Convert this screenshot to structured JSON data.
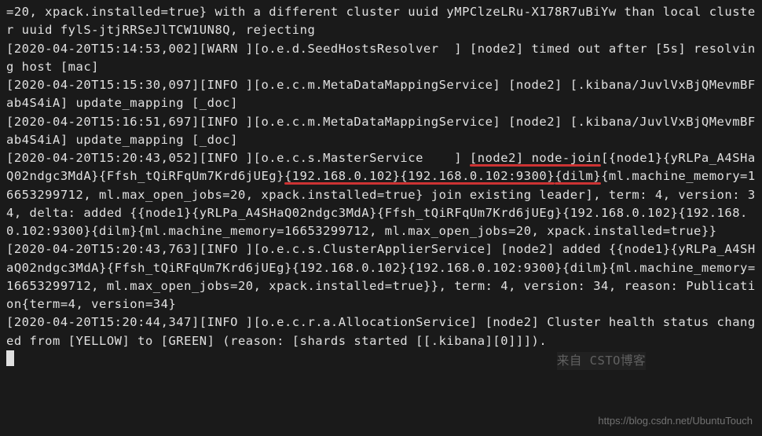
{
  "log": {
    "line1": "=20, xpack.installed=true} with a different cluster uuid yMPClzeLRu-X178R7uBiYw than local cluster uuid fylS-jtjRRSeJlTCW1UN8Q, rejecting",
    "line2": "[2020-04-20T15:14:53,002][WARN ][o.e.d.SeedHostsResolver  ] [node2] timed out after [5s] resolving host [mac]",
    "line3": "[2020-04-20T15:15:30,097][INFO ][o.e.c.m.MetaDataMappingService] [node2] [.kibana/JuvlVxBjQMevmBFab4S4iA] update_mapping [_doc]",
    "line4": "[2020-04-20T15:16:51,697][INFO ][o.e.c.m.MetaDataMappingService] [node2] [.kibana/JuvlVxBjQMevmBFab4S4iA] update_mapping [_doc]",
    "line5_pre": "[2020-04-20T15:20:43,052][INFO ][o.e.c.s.MasterService    ] ",
    "line5_hl1": "[node2] node-join",
    "line5_mid1": "[{node1}{yRLPa_A4SHaQ02ndgc3MdA}{Ffsh_tQiRFqUm7Krd6jUEg}",
    "line5_hl2": "{192.168.0.102}{192.168.0.102:9300}",
    "line5_hl3": "{dilm}",
    "line5_post": "{ml.machine_memory=16653299712, ml.max_open_jobs=20, xpack.installed=true} join existing leader], term: 4, version: 34, delta: added {{node1}{yRLPa_A4SHaQ02ndgc3MdA}{Ffsh_tQiRFqUm7Krd6jUEg}{192.168.0.102}{192.168.0.102:9300}{dilm}{ml.machine_memory=16653299712, ml.max_open_jobs=20, xpack.installed=true}}",
    "line6": "[2020-04-20T15:20:43,763][INFO ][o.e.c.s.ClusterApplierService] [node2] added {{node1}{yRLPa_A4SHaQ02ndgc3MdA}{Ffsh_tQiRFqUm7Krd6jUEg}{192.168.0.102}{192.168.0.102:9300}{dilm}{ml.machine_memory=16653299712, ml.max_open_jobs=20, xpack.installed=true}}, term: 4, version: 34, reason: Publication{term=4, version=34}",
    "line7": "[2020-04-20T15:20:44,347][INFO ][o.e.c.r.a.AllocationService] [node2] Cluster health status changed from [YELLOW] to [GREEN] (reason: [shards started [[.kibana][0]]]).",
    "faded_text": "来自 CSTO博客"
  },
  "watermark": "https://blog.csdn.net/UbuntuTouch"
}
